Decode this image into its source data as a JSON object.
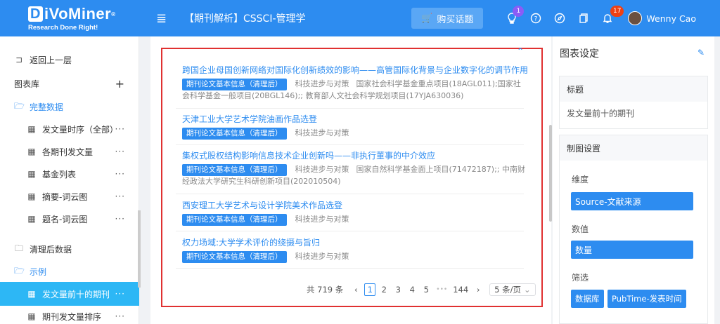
{
  "header": {
    "logo_main": "iVoMiner",
    "logo_di": "D",
    "logo_reg": "®",
    "logo_sub": "Research Done Right!",
    "menu_icon": "≣",
    "title": "【期刊解析】CSSCI-管理学",
    "buy_label": "购买话题",
    "buy_icon": "🛒",
    "bulb_badge": "1",
    "bell_badge": "17",
    "user_name": "Wenny Cao"
  },
  "sidebar": {
    "back": "返回上一层",
    "library": "图表库",
    "add": "+",
    "folder_complete": "完整数据",
    "items_complete": [
      "发文量时序（全部）",
      "各期刊发文量",
      "基金列表",
      "摘要-词云图",
      "题名-词云图"
    ],
    "folder_clean": "清理后数据",
    "folder_example": "示例",
    "items_example": [
      "发文量前十的期刊",
      "期刊发文量排序"
    ],
    "more": "···"
  },
  "main": {
    "entries": [
      {
        "title": "跨国企业母国创新网络对国际化创新绩效的影响——高管国际化背景与企业数字化的调节作用",
        "tag": "期刊论文基本信息（清理后）",
        "source": "科技进步与对策",
        "fund_line1": "国家社会科学基金重点项目(18AGL011);国家社",
        "fund_line2": "会科学基金一般项目(20BGL146);; 教育部人文社会科学规划项目(17YJA630036)"
      },
      {
        "title": "天津工业大学艺术学院油画作品选登",
        "tag": "期刊论文基本信息（清理后）",
        "source": "科技进步与对策",
        "fund_line1": "",
        "fund_line2": ""
      },
      {
        "title": "集权式股权结构影响信息技术企业创新吗——非执行董事的中介效应",
        "tag": "期刊论文基本信息（清理后）",
        "source": "科技进步与对策",
        "fund_line1": "国家自然科学基金面上项目(71472187);; 中南财",
        "fund_line2": "经政法大学研究生科研创新项目(202010504)"
      },
      {
        "title": "西安理工大学艺术与设计学院美术作品选登",
        "tag": "期刊论文基本信息（清理后）",
        "source": "科技进步与对策",
        "fund_line1": "",
        "fund_line2": ""
      },
      {
        "title": "权力场域:大学学术评价的绕摄与旨归",
        "tag": "期刊论文基本信息（清理后）",
        "source": "科技进步与对策",
        "fund_line1": "",
        "fund_line2": ""
      }
    ],
    "pager": {
      "total": "共 719 条",
      "prev": "‹",
      "pages": [
        "1",
        "2",
        "3",
        "4",
        "5"
      ],
      "ellipsis": "•••",
      "last": "144",
      "next": "›",
      "size": "5 条/页",
      "size_caret": "⌄"
    },
    "collapse": "⌃"
  },
  "right": {
    "title": "图表设定",
    "edit_icon": "✎",
    "sec_title_head": "标题",
    "sec_title_value": "发文量前十的期刊",
    "sec_chart_head": "制图设置",
    "label_dim": "维度",
    "dim_value": "Source-文献来源",
    "label_val": "数值",
    "val_value": "数量",
    "label_filter": "筛选",
    "filter_chips": [
      "数据库",
      "PubTime-发表时间"
    ]
  }
}
